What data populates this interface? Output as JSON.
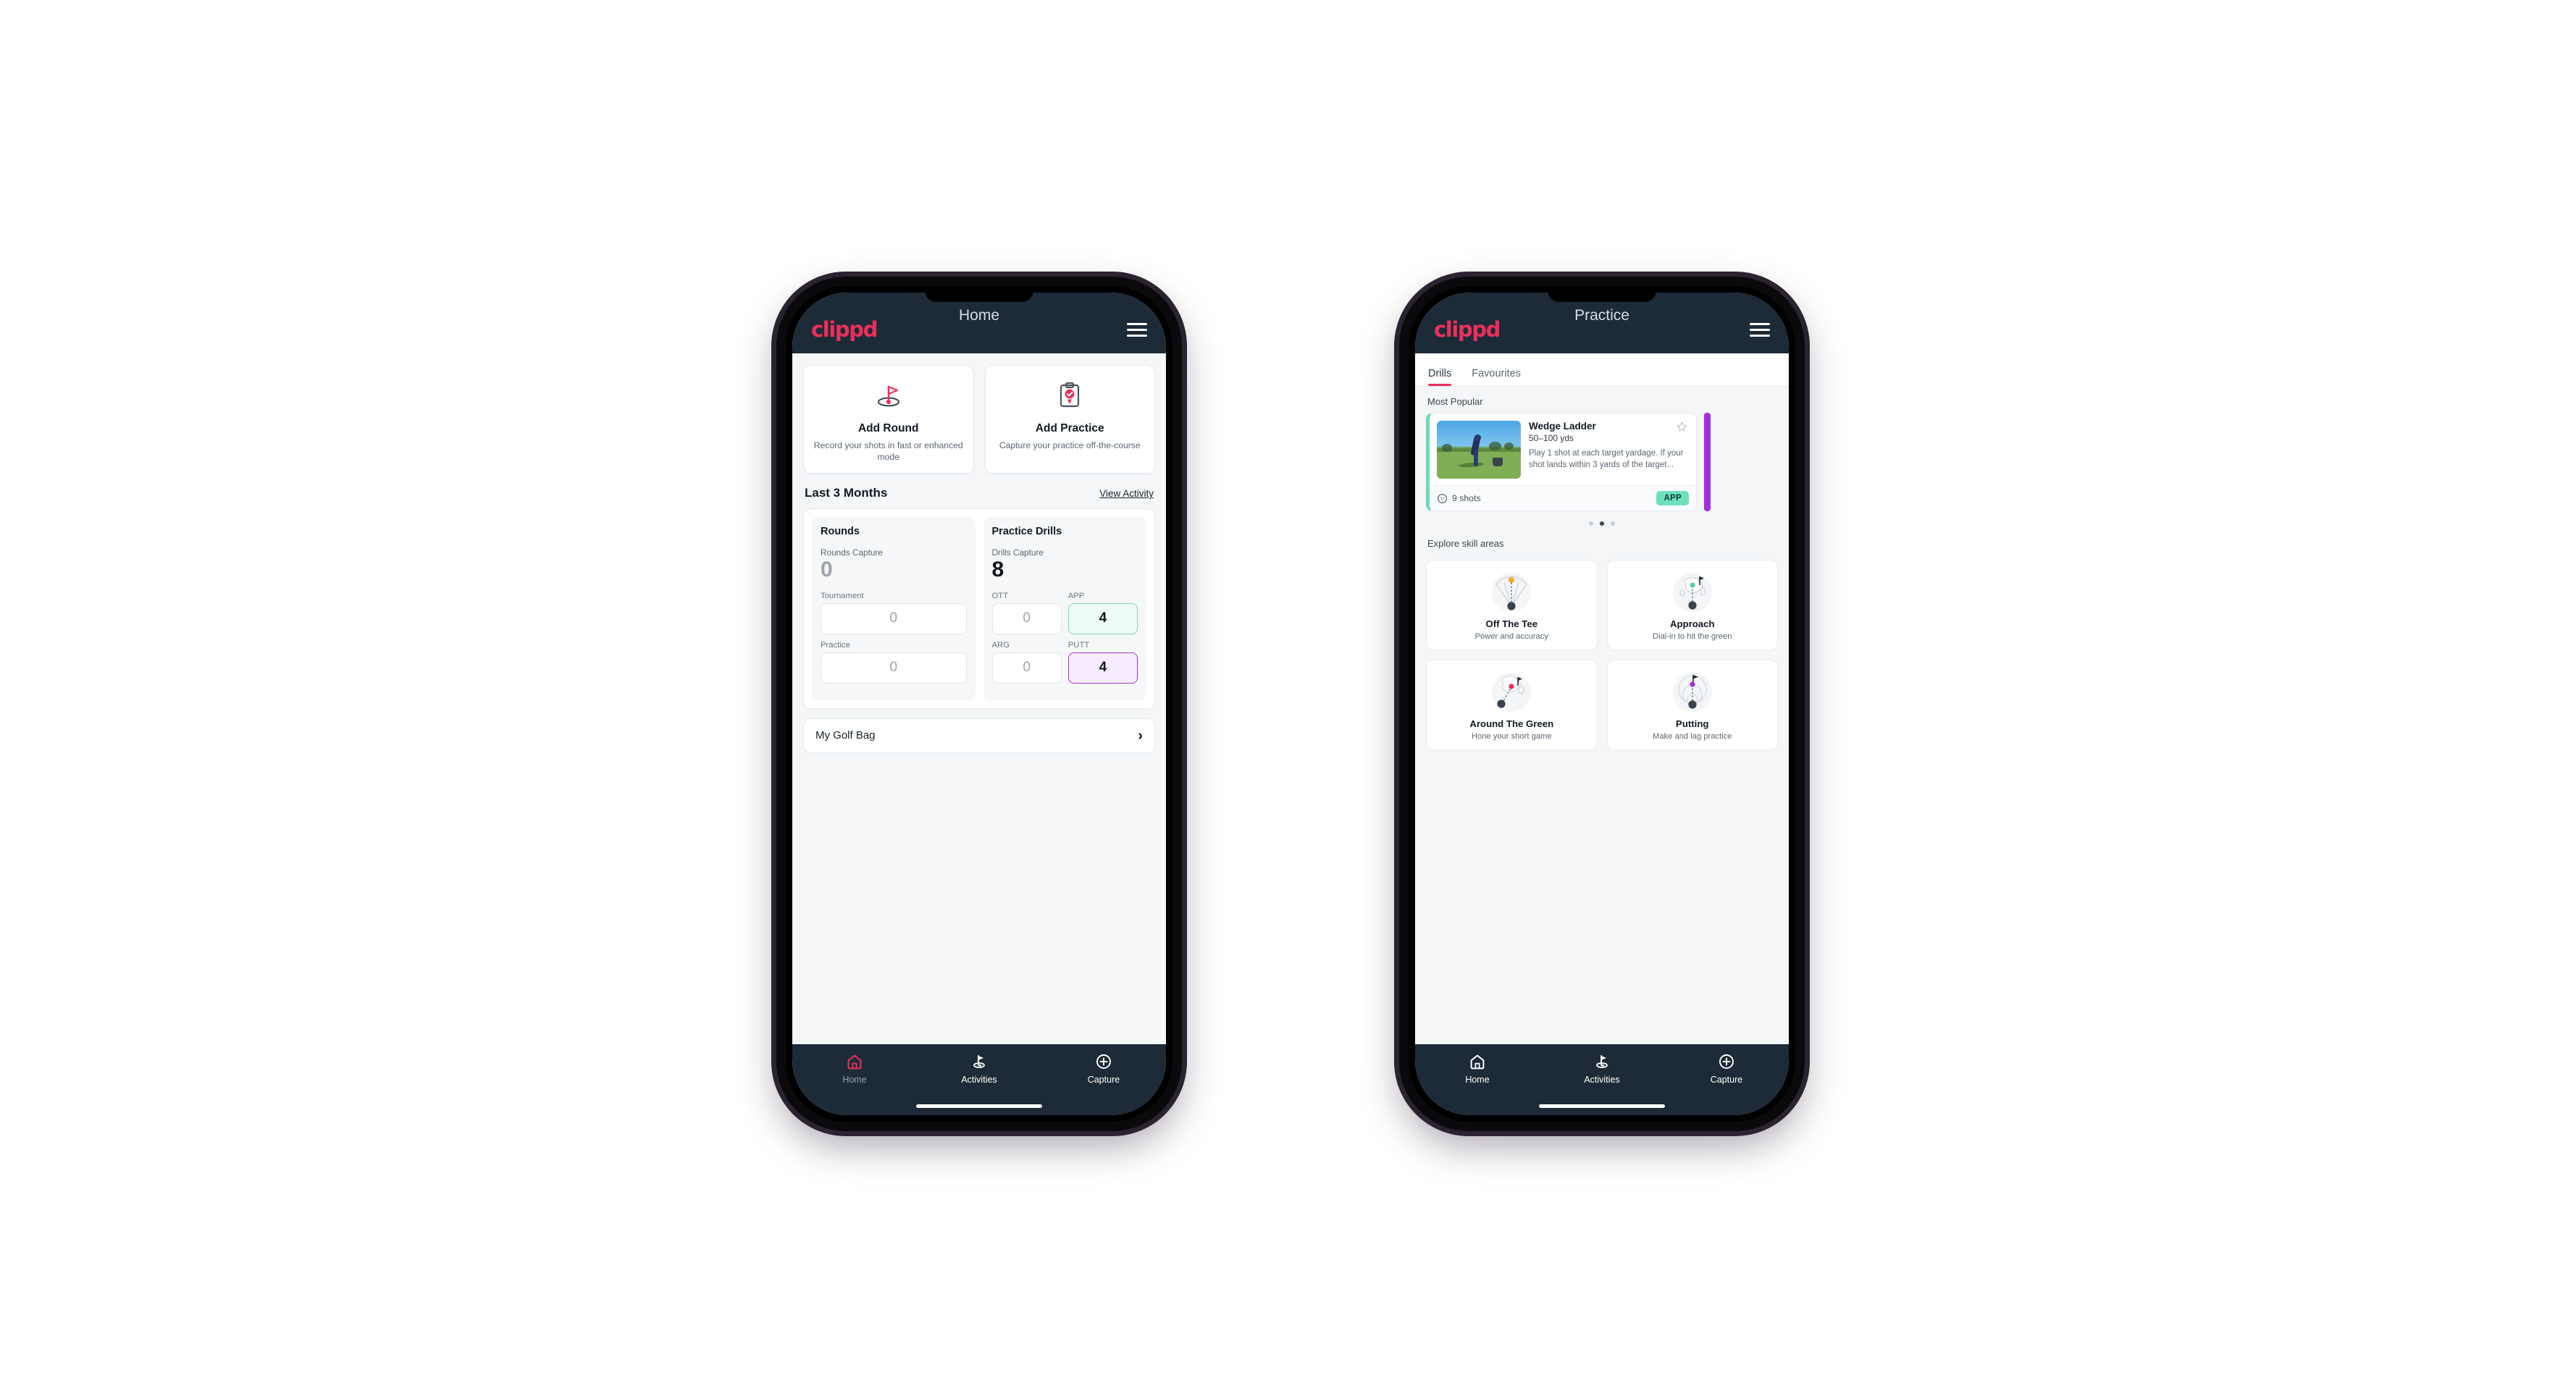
{
  "brand": {
    "logo_text": "clippd",
    "accent_pink": "#ec2f5b",
    "header_navy": "#1d2b38",
    "teal": "#6fe0bc",
    "purple": "#9b39c9"
  },
  "phone_home": {
    "header": {
      "logo": "clippd",
      "title": "Home",
      "menu_icon": "hamburger-menu-icon"
    },
    "quick_actions": [
      {
        "icon": "golf-flag-icon",
        "title": "Add Round",
        "subtitle": "Record your shots in fast or enhanced mode"
      },
      {
        "icon": "clipboard-check-icon",
        "title": "Add Practice",
        "subtitle": "Capture your practice off-the-course"
      }
    ],
    "section": {
      "title": "Last 3 Months",
      "link": "View Activity"
    },
    "rounds": {
      "heading": "Rounds",
      "capture_label": "Rounds Capture",
      "capture_value": "0",
      "fields": [
        {
          "label": "Tournament",
          "value": "0"
        },
        {
          "label": "Practice",
          "value": "0"
        }
      ]
    },
    "practice_drills": {
      "heading": "Practice Drills",
      "capture_label": "Drills Capture",
      "capture_value": "8",
      "fields": [
        {
          "label": "OTT",
          "value": "0",
          "state": "plain"
        },
        {
          "label": "APP",
          "value": "4",
          "state": "teal"
        },
        {
          "label": "ARG",
          "value": "0",
          "state": "plain"
        },
        {
          "label": "PUTT",
          "value": "4",
          "state": "purple"
        }
      ]
    },
    "golf_bag": {
      "label": "My Golf Bag",
      "chevron": "chevron-right-icon"
    },
    "bottom_nav": {
      "active": "Home",
      "items": [
        {
          "label": "Home",
          "icon": "home-icon"
        },
        {
          "label": "Activities",
          "icon": "golf-flag-icon"
        },
        {
          "label": "Capture",
          "icon": "plus-circle-icon"
        }
      ]
    }
  },
  "phone_practice": {
    "header": {
      "logo": "clippd",
      "title": "Practice",
      "menu_icon": "hamburger-menu-icon"
    },
    "tabs": [
      {
        "label": "Drills",
        "active": true
      },
      {
        "label": "Favourites",
        "active": false
      }
    ],
    "most_popular": {
      "label": "Most Popular",
      "drill": {
        "title": "Wedge Ladder",
        "yardage": "50–100 yds",
        "description": "Play 1 shot at each target yardage. If your shot lands within 3 yards of the target...",
        "shots": "9 shots",
        "shots_icon": "golf-ball-icon",
        "category_chip": "APP",
        "favourite_icon": "star-outline-icon",
        "accent_color": "#6fd9b8",
        "thumbnail": "golfer-wedge-shot-photo"
      },
      "carousel_dots": {
        "count": 3,
        "active_index": 1
      }
    },
    "skill_areas": {
      "label": "Explore skill areas",
      "cards": [
        {
          "title": "Off The Tee",
          "subtitle": "Power and accuracy",
          "icon": "tee-dispersion-icon"
        },
        {
          "title": "Approach",
          "subtitle": "Dial-in to hit the green",
          "icon": "approach-green-icon"
        },
        {
          "title": "Around The Green",
          "subtitle": "Hone your short game",
          "icon": "chip-green-icon"
        },
        {
          "title": "Putting",
          "subtitle": "Make and lag practice",
          "icon": "putting-rings-icon"
        }
      ]
    },
    "bottom_nav": {
      "active": "Activities",
      "items": [
        {
          "label": "Home",
          "icon": "home-icon"
        },
        {
          "label": "Activities",
          "icon": "golf-flag-icon"
        },
        {
          "label": "Capture",
          "icon": "plus-circle-icon"
        }
      ]
    }
  }
}
